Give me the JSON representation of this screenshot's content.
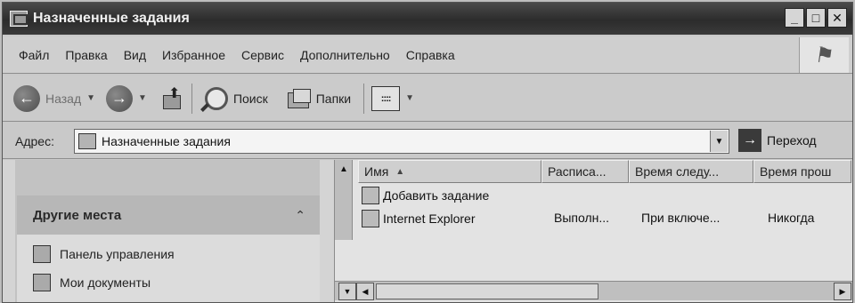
{
  "window": {
    "title": "Назначенные задания",
    "minimize_glyph": "_",
    "maximize_glyph": "□",
    "close_glyph": "✕"
  },
  "menu": {
    "items": [
      "Файл",
      "Правка",
      "Вид",
      "Избранное",
      "Сервис",
      "Дополнительно",
      "Справка"
    ]
  },
  "toolbar": {
    "back_label": "Назад",
    "search_label": "Поиск",
    "folders_label": "Папки"
  },
  "address": {
    "label": "Адрес:",
    "value": "Назначенные задания",
    "go_label": "Переход"
  },
  "taskpane": {
    "section_title": "Другие места",
    "places": [
      "Панель управления",
      "Мои документы"
    ]
  },
  "list": {
    "columns": [
      "Имя",
      "Расписа...",
      "Время следу...",
      "Время прош"
    ],
    "rows": [
      {
        "name": "Добавить задание",
        "schedule": "",
        "next_run": "",
        "last_run": ""
      },
      {
        "name": "Internet Explorer",
        "schedule": "Выполн...",
        "next_run": "При включе...",
        "last_run": "Никогда"
      }
    ]
  }
}
